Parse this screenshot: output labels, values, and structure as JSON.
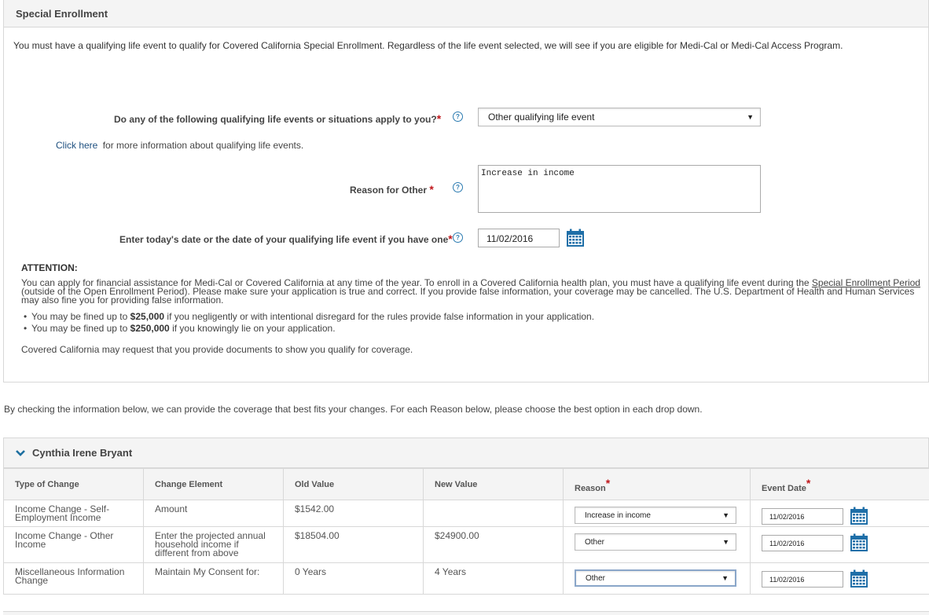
{
  "panel": {
    "title": "Special Enrollment"
  },
  "intro": "You must have a qualifying life event to qualify for Covered California Special Enrollment. Regardless of the life event selected, we will see if you are eligible for Medi-Cal or Medi-Cal Access Program.",
  "question": {
    "label": "Do any of the following qualifying life events or situations apply to you?",
    "required_mark": "*",
    "selected": "Other qualifying life event"
  },
  "click_here": {
    "link": "Click here",
    "text": "for more information about qualifying life events."
  },
  "reason_other": {
    "label": "Reason for Other",
    "required_mark": "*",
    "value": "Increase in income"
  },
  "event_date": {
    "label": "Enter today's date or the date of your qualifying life event if you have one",
    "required_mark": "*",
    "value": "11/02/2016"
  },
  "attention": {
    "title": "ATTENTION:",
    "para_before": "You can apply for financial assistance for Medi-Cal or Covered California at any time of the year. To enroll in a Covered California health plan, you must have a qualifying life event during the",
    "para_link": "Special Enrollment Period",
    "para_after": "(outside of the Open Enrollment Period). Please make sure your application is true and correct. If you provide false information, your coverage may be cancelled. The U.S. Department of Health and Human Services may also fine you for providing false information.",
    "bullet1_pre": "You may be fined up to",
    "bullet1_amount": "$25,000",
    "bullet1_post": "if you negligently or with intentional disregard for the rules provide false information in your application.",
    "bullet2_pre": "You may be fined up to",
    "bullet2_amount": "$250,000",
    "bullet2_post": "if you knowingly lie on your application.",
    "closing": "Covered California may request that you provide documents to show you qualify for coverage."
  },
  "by_checking": "By checking the information below, we can provide the coverage that best fits your changes. For each Reason below, please choose the best option in each drop down.",
  "person": {
    "name": "Cynthia Irene Bryant"
  },
  "table": {
    "headers": {
      "type": "Type of Change",
      "element": "Change Element",
      "old": "Old Value",
      "new": "New Value",
      "reason": "Reason",
      "date": "Event Date",
      "required_mark": "*"
    },
    "rows": [
      {
        "type": "Income Change - Self-Employment Income",
        "element": "Amount",
        "old": "$1542.00",
        "new": "",
        "reason": "Increase in income",
        "date": "11/02/2016"
      },
      {
        "type": "Income Change - Other Income",
        "element": "Enter the projected annual household income if different from above",
        "old": "$18504.00",
        "new": "$24900.00",
        "reason": "Other",
        "date": "11/02/2016"
      },
      {
        "type": "Miscellaneous Information Change",
        "element": "Maintain My Consent for:",
        "old": "0 Years",
        "new": "4 Years",
        "reason": "Other",
        "date": "11/02/2016"
      }
    ]
  },
  "icons": {
    "help": "help-circle-icon",
    "calendar": "calendar-icon",
    "chevron": "chevron-down-icon"
  },
  "colors": {
    "required": "#c0171c",
    "link": "#1d4f7f",
    "calendar": "#2a7ab0"
  }
}
